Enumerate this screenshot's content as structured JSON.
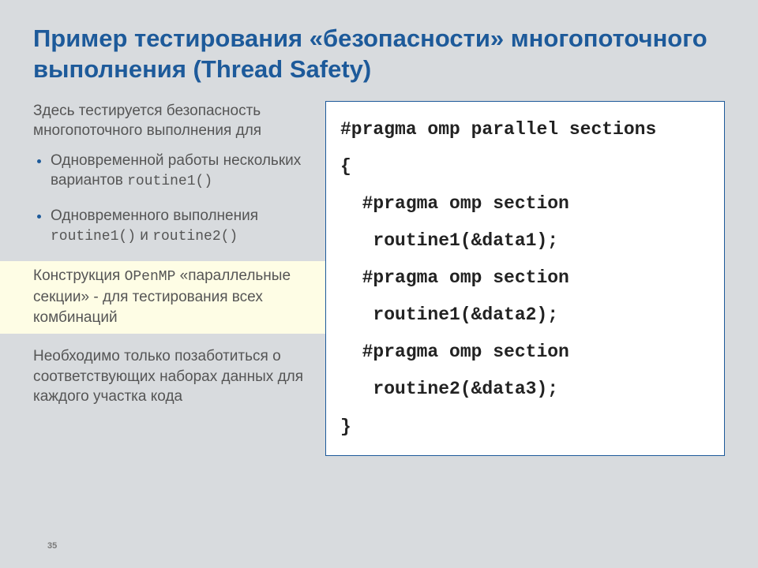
{
  "title": "Пример тестирования «безопасности» многопоточного выполнения (Thread Safety)",
  "left": {
    "intro": "Здесь тестируется безопасность многопоточного выполнения для",
    "bullets": [
      {
        "pre": "Одновременной работы нескольких вариантов ",
        "code": "routine1()",
        "post": ""
      },
      {
        "pre": "Одновременного выполнения ",
        "code": "routine1()",
        "mid": " и ",
        "code2": "routine2()"
      }
    ],
    "hl_pre": "Конструкция ",
    "hl_code": "OPenMP",
    "hl_post": " «параллельные секции» - для тестирования всех комбинаций",
    "note": "Необходимо только позаботиться о соответствующих наборах данных для каждого участка кода"
  },
  "code": "#pragma omp parallel sections\n{\n  #pragma omp section\n   routine1(&data1);\n  #pragma omp section\n   routine1(&data2);\n  #pragma omp section\n   routine2(&data3);\n}",
  "page": "35"
}
